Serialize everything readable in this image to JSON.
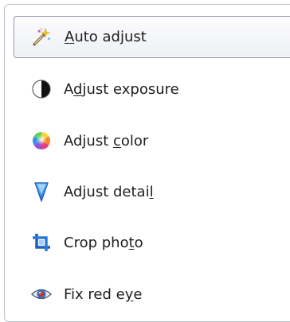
{
  "menu": {
    "items": [
      {
        "id": "auto-adjust",
        "label": {
          "pre": "",
          "key": "A",
          "post": "uto adjust"
        },
        "icon": "magic-wand-icon",
        "selected": true
      },
      {
        "id": "adjust-exposure",
        "label": {
          "pre": "A",
          "key": "d",
          "post": "just exposure"
        },
        "icon": "exposure-icon",
        "selected": false
      },
      {
        "id": "adjust-color",
        "label": {
          "pre": "Adjust ",
          "key": "c",
          "post": "olor"
        },
        "icon": "color-wheel-icon",
        "selected": false
      },
      {
        "id": "adjust-detail",
        "label": {
          "pre": "Adjust detai",
          "key": "l",
          "post": ""
        },
        "icon": "detail-icon",
        "selected": false
      },
      {
        "id": "crop-photo",
        "label": {
          "pre": "Crop pho",
          "key": "t",
          "post": "o"
        },
        "icon": "crop-icon",
        "selected": false
      },
      {
        "id": "fix-red-eye",
        "label": {
          "pre": "Fix red e",
          "key": "y",
          "post": "e"
        },
        "icon": "red-eye-icon",
        "selected": false
      }
    ]
  }
}
